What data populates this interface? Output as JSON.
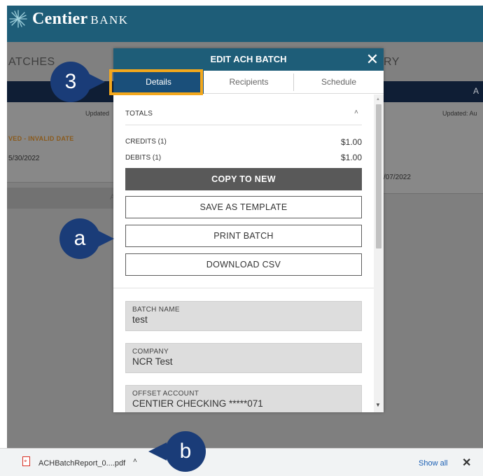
{
  "header": {
    "brand_name": "Centier",
    "brand_suffix": "BANK"
  },
  "background": {
    "tab_left": "ATCHES",
    "tab_right": "RY",
    "navy_letter": "A",
    "updated_left": "Updated",
    "updated_right": "Updated: Au",
    "status": "VED - INVALID DATE",
    "date_left": "5/30/2022",
    "date_right": "/07/2022",
    "bar_letter": "A"
  },
  "modal": {
    "title": "EDIT ACH BATCH",
    "close_glyph": "✕",
    "tabs": [
      {
        "label": "Details",
        "active": true
      },
      {
        "label": "Recipients",
        "active": false
      },
      {
        "label": "Schedule",
        "active": false
      }
    ],
    "totals": {
      "label": "TOTALS",
      "caret": "˄",
      "rows": [
        {
          "label": "CREDITS (1)",
          "value": "$1.00"
        },
        {
          "label": "DEBITS (1)",
          "value": "$1.00"
        }
      ]
    },
    "buttons": {
      "copy": "COPY TO NEW",
      "template": "SAVE AS TEMPLATE",
      "print": "PRINT BATCH",
      "download": "DOWNLOAD CSV"
    },
    "fields": [
      {
        "label": "BATCH NAME",
        "value": "test"
      },
      {
        "label": "COMPANY",
        "value": "NCR Test"
      },
      {
        "label": "OFFSET ACCOUNT",
        "value": "CENTIER CHECKING *****071"
      }
    ]
  },
  "callouts": {
    "step3": "3",
    "a": "a",
    "b": "b"
  },
  "downloads": {
    "file_name": "ACHBatchReport_0....pdf",
    "chevron": "˄",
    "show_all": "Show all",
    "close_glyph": "✕"
  },
  "colors": {
    "brand": "#1e5d78",
    "active_tab": "#1a4f7a",
    "highlight": "#f4a81c",
    "callout": "#1a3c78"
  }
}
